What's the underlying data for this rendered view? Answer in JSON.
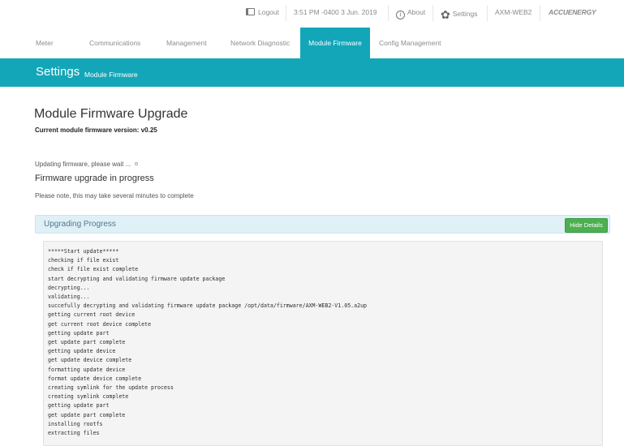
{
  "topbar": {
    "logout_label": "Logout",
    "datetime": "3:51 PM -0400 3 Jun. 2019",
    "about_label": "About",
    "settings_label": "Settings",
    "device_name": "AXM-WEB2",
    "logo_text": "ACCUENERGY"
  },
  "nav": {
    "tabs": [
      {
        "label": "Meter"
      },
      {
        "label": "Communications"
      },
      {
        "label": "Management"
      },
      {
        "label": "Network Diagnostic"
      },
      {
        "label": "Module Firmware"
      },
      {
        "label": "Config Management"
      }
    ],
    "active_index": 4
  },
  "banner": {
    "title": "Settings",
    "subtitle": "Module Firmware"
  },
  "main": {
    "heading": "Module Firmware Upgrade",
    "current_version": "Current module firmware version: v0.25",
    "updating_text": "Updating firmware, please wait ...",
    "in_progress": "Firmware upgrade in progress",
    "note": "Please note, this may take several minutes to complete"
  },
  "progress_panel": {
    "title": "Upgrading Progress",
    "hide_button": "Hide Details",
    "log_lines": [
      "*****Start update*****",
      "checking if file exist",
      "check if file exist complete",
      "start decrypting and validating firmware update package",
      "decrypting...",
      "validating...",
      "succefully decrypting and validating firmware update package /opt/data/firmware/AXM-WEB2-V1.05.a2up",
      "getting current root device",
      "get current root device complete",
      "getting update part",
      "get update part complete",
      "getting update device",
      "get update device complete",
      "formatting update device",
      "format update device complete",
      "creating symlink for the update process",
      "creating symlink complete",
      "getting update part",
      "get update part complete",
      "installing rootfs",
      "extracting files"
    ]
  },
  "colors": {
    "accent": "#13a6b8",
    "panel_header_bg": "#dff0f7",
    "button_green": "#4caf50",
    "logo_blue": "#1a3fa8"
  },
  "icons": {
    "logout": "logout-icon",
    "about": "info-icon",
    "settings": "gear-icon"
  }
}
